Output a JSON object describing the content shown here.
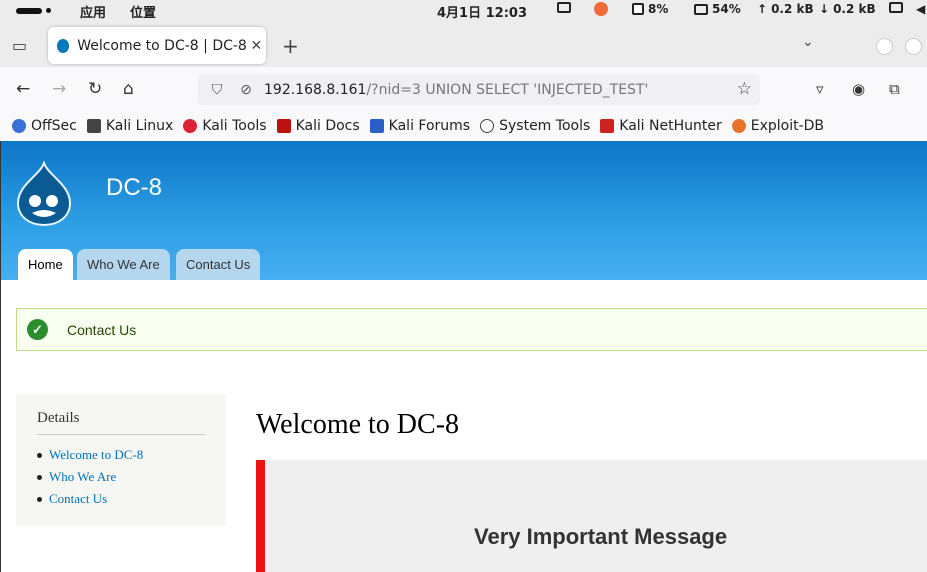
{
  "system_bar": {
    "menu_apps": "应用",
    "menu_places": "位置",
    "datetime": "4月1日  12:03",
    "cpu": "8%",
    "memory": "54%",
    "net_up": "0.2 kB",
    "net_down": "0.2 kB"
  },
  "browser": {
    "tab_title": "Welcome to DC-8 | DC-8",
    "url_host": "192.168.8.161",
    "url_path": "/?nid=3 UNION SELECT 'INJECTED_TEST'",
    "bookmarks": [
      "OffSec",
      "Kali Linux",
      "Kali Tools",
      "Kali Docs",
      "Kali Forums",
      "System Tools",
      "Kali NetHunter",
      "Exploit-DB"
    ]
  },
  "site": {
    "name": "DC-8",
    "tabs": [
      "Home",
      "Who We Are",
      "Contact Us"
    ],
    "status_message": "Contact Us",
    "sidebar_title": "Details",
    "sidebar_links": [
      "Welcome to DC-8",
      "Who We Are",
      "Contact Us"
    ],
    "page_title": "Welcome to DC-8",
    "message_heading": "Very Important Message"
  },
  "colors": {
    "hero_top": "#0e76c7",
    "hero_bottom": "#48aef0",
    "alert_border": "#ee1111",
    "link": "#0071b3"
  }
}
